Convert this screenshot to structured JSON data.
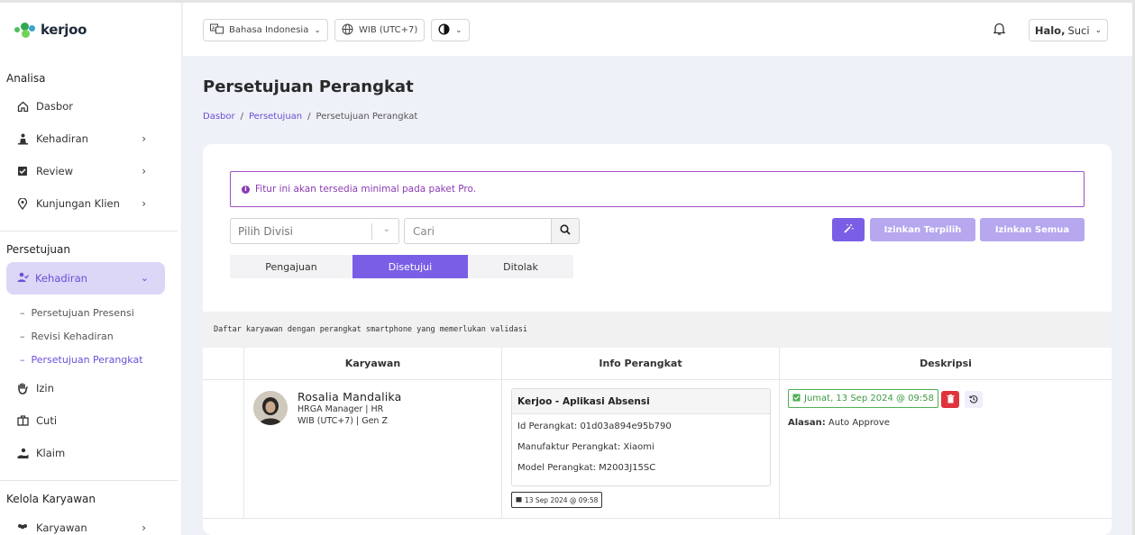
{
  "brand": {
    "name": "kerjoo"
  },
  "sidebar": {
    "sections": {
      "analisa": "Analisa",
      "persetujuan": "Persetujuan",
      "kelola": "Kelola Karyawan"
    },
    "analisa_items": [
      {
        "label": "Dasbor",
        "icon": "home-icon"
      },
      {
        "label": "Kehadiran",
        "icon": "person-attendance-icon"
      },
      {
        "label": "Review",
        "icon": "checkbox-icon"
      },
      {
        "label": "Kunjungan Klien",
        "icon": "map-pin-icon"
      }
    ],
    "active_item": {
      "label": "Kehadiran",
      "icon": "user-check-icon"
    },
    "submenu": [
      {
        "label": "Persetujuan Presensi"
      },
      {
        "label": "Revisi Kehadiran"
      },
      {
        "label": "Persetujuan Perangkat"
      }
    ],
    "persetujuan_items": [
      {
        "label": "Izin",
        "icon": "hand-icon"
      },
      {
        "label": "Cuti",
        "icon": "calendar-icon"
      },
      {
        "label": "Klaim",
        "icon": "money-hand-icon"
      }
    ],
    "kelola_items": [
      {
        "label": "Karyawan",
        "icon": "users-icon"
      }
    ],
    "dash": "–"
  },
  "header": {
    "language": "Bahasa Indonesia",
    "timezone": "WIB (UTC+7)",
    "greeting_prefix": "Halo,",
    "user_name": "Suci"
  },
  "page": {
    "title": "Persetujuan Perangkat",
    "breadcrumb": [
      "Dasbor",
      "Persetujuan",
      "Persetujuan Perangkat"
    ],
    "breadcrumb_sep": "/"
  },
  "alert": {
    "text": "Fitur ini akan tersedia minimal pada paket Pro."
  },
  "filters": {
    "divisi_placeholder": "Pilih Divisi",
    "search_placeholder": "Cari"
  },
  "actions": {
    "allow_selected": "Izinkan Terpilih",
    "allow_all": "Izinkan Semua"
  },
  "tabs": [
    "Pengajuan",
    "Disetujui",
    "Ditolak"
  ],
  "active_tab": "Disetujui",
  "table": {
    "description": "Daftar karyawan dengan perangkat smartphone yang memerlukan validasi",
    "columns": [
      "Karyawan",
      "Info Perangkat",
      "Deskripsi"
    ],
    "rows": [
      {
        "name": "Rosalia Mandalika",
        "position_line": "HRGA Manager | HR",
        "tz_line": "WIB (UTC+7) | Gen Z",
        "device_app": "Kerjoo - Aplikasi Absensi",
        "device_id": "Id Perangkat: 01d03a894e95b790",
        "manufacturer": "Manufaktur Perangkat: Xiaomi",
        "model": "Model Perangkat: M2003J15SC",
        "registered": "13 Sep 2024 @ 09:58",
        "approved_date": "Jumat, 13 Sep 2024 @ 09:58",
        "reason_label": "Alasan:",
        "reason_value": "Auto Approve"
      }
    ]
  },
  "colors": {
    "accent": "#7a5fe6",
    "accent_light": "#b6a7ef",
    "danger": "#e0343c",
    "success": "#4caf50",
    "alert_border": "#a04fc7"
  }
}
